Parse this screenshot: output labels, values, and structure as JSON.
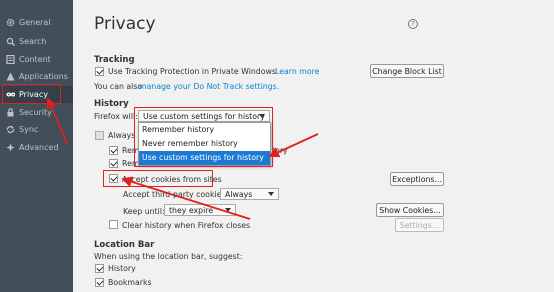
{
  "sidebar": {
    "items": [
      {
        "label": "General",
        "icon": "gear-icon"
      },
      {
        "label": "Search",
        "icon": "search-icon"
      },
      {
        "label": "Content",
        "icon": "content-icon"
      },
      {
        "label": "Applications",
        "icon": "applications-icon"
      },
      {
        "label": "Privacy",
        "icon": "mask-icon"
      },
      {
        "label": "Security",
        "icon": "lock-icon"
      },
      {
        "label": "Sync",
        "icon": "sync-icon"
      },
      {
        "label": "Advanced",
        "icon": "wizard-icon"
      }
    ]
  },
  "page": {
    "title": "Privacy",
    "help_icon": "?"
  },
  "tracking": {
    "heading": "Tracking",
    "use_tp_label": "Use Tracking Protection in Private Windows",
    "learn_more": "Learn more",
    "change_block_list": "Change Block List",
    "dnt_prefix": "You can also ",
    "dnt_link": "manage your Do Not Track settings."
  },
  "history": {
    "heading": "History",
    "firefox_will": "Firefox will:",
    "select_value": "Use custom settings for history",
    "options": [
      "Remember history",
      "Never remember history",
      "Use custom settings for history"
    ],
    "selected_index": 2,
    "always_label": "Always u",
    "rem1_label": "Rem",
    "rem1_suffix": "tory",
    "rem2_label": "Rem",
    "accept_cookies": "Accept cookies from sites",
    "exceptions": "Exceptions...",
    "third_party_label": "Accept third-party cookies:",
    "third_party_value": "Always",
    "keep_until_label": "Keep until:",
    "keep_until_value": "they expire",
    "show_cookies": "Show Cookies...",
    "clear_history": "Clear history when Firefox closes",
    "settings": "Settings..."
  },
  "location_bar": {
    "heading": "Location Bar",
    "when_using": "When using the location bar, suggest:",
    "history": "History",
    "bookmarks": "Bookmarks"
  },
  "colors": {
    "accent": "#1c7ad4",
    "annotation": "#e02020",
    "sidebar_bg": "#424f5a"
  }
}
